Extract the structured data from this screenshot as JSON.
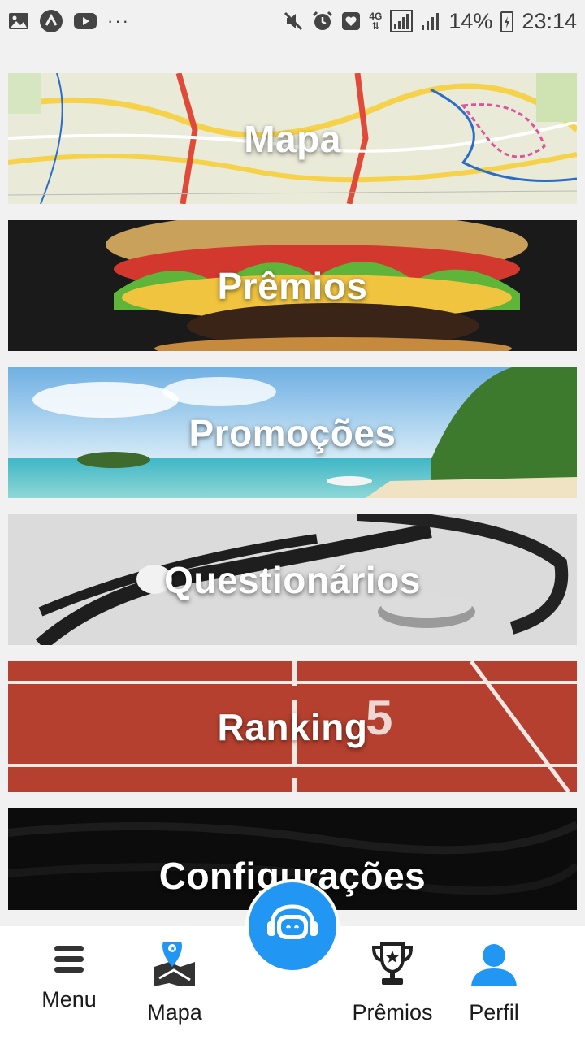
{
  "status_bar": {
    "left_icons": [
      "image-icon",
      "app-icon",
      "youtube-icon",
      "more-icon"
    ],
    "more_text": "···",
    "network": "4G",
    "battery": "14%",
    "time": "23:14"
  },
  "cards": [
    {
      "id": "mapa",
      "label": "Mapa"
    },
    {
      "id": "premios",
      "label": "Prêmios"
    },
    {
      "id": "promocoes",
      "label": "Promoções"
    },
    {
      "id": "questionarios",
      "label": "Questionários"
    },
    {
      "id": "ranking",
      "label": "Ranking"
    },
    {
      "id": "configuracoes",
      "label": "Configurações"
    }
  ],
  "bottom_nav": {
    "menu": "Menu",
    "mapa": "Mapa",
    "premios": "Prêmios",
    "perfil": "Perfil",
    "assistant_icon": "robot-headset-icon"
  },
  "colors": {
    "fab": "#2196f3",
    "perfil_icon": "#2196f3",
    "background": "#f1f1f1"
  }
}
